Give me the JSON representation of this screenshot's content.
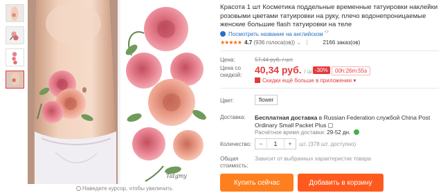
{
  "product": {
    "title": "Красота 1 шт Косметика поддельные временные татуировки наклейки розовыми цветами татуировки на руку, плечо водонепроницаемые женские большие flash татуировки на теле",
    "translate_link": "Посмотреть название на английском",
    "rating_score": "4.7",
    "rating_votes": "(936 голоса(ов))",
    "orders": "2166 заказ(ов)"
  },
  "price": {
    "label": "Цена:",
    "old_value": "57,44 руб. / шт.",
    "discount_label": "Цена со скидкой:",
    "new_value": "40,34 руб.",
    "new_unit": "/ шт.",
    "discount_badge": "-30%",
    "timer": "00h:26m:55s",
    "app_discount": "Скидки ещё больше в приложении"
  },
  "options": {
    "color_label": "Цвет:",
    "color_value": "flower"
  },
  "delivery": {
    "label": "Доставка:",
    "free": "Бесплатная доставка",
    "to": "в",
    "region": "Russian Federation",
    "carrier_prefix": "службой",
    "carrier": "China Post Ordinary Small Packet Plus",
    "time_label": "Расчётное время доставки:",
    "time_value": "29-52 дн."
  },
  "quantity": {
    "label": "Количество:",
    "minus": "−",
    "value": "1",
    "plus": "+",
    "stock": "шт. (378 шт. доступно)"
  },
  "total": {
    "label": "Общая стоимость:",
    "note": "Зависит от выбранных характеристик товара"
  },
  "buttons": {
    "buy": "Купить сейчас",
    "cart": "Добавить в корзину"
  },
  "zoom_hint": "Наведите курсор, чтобы увеличить",
  "watermark": "Tatgmy",
  "icons": {
    "heart": "heart-icon",
    "stars": "star-icon",
    "globe": "globe-icon",
    "qr": "qr-icon",
    "info": "info-icon",
    "magnifier": "magnifier-icon"
  },
  "colors": {
    "accent_red": "#e4393c",
    "buy_button": "#ff7e1d",
    "cart_button": "#ff5a1e",
    "link": "#2770c4"
  }
}
